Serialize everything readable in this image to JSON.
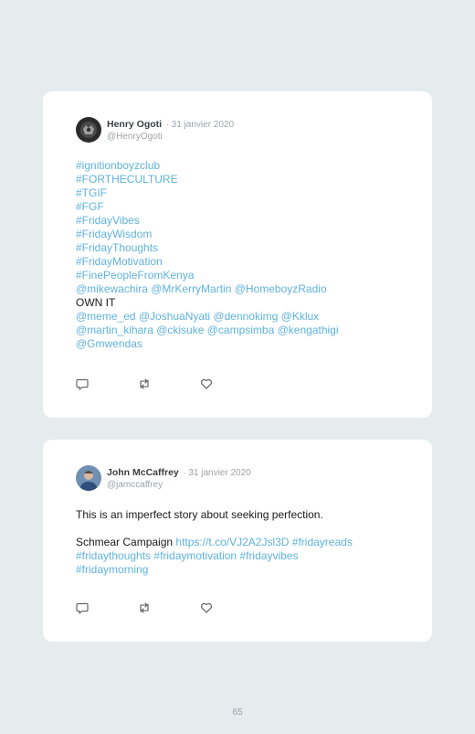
{
  "tweets": [
    {
      "name": "Henry Ogoti",
      "date": "· 31 janvier 2020",
      "handle": "@HenryOgoti",
      "lines": [
        [
          {
            "t": "#ignitionboyzclub",
            "link": true
          }
        ],
        [
          {
            "t": "#FORTHECULTURE",
            "link": true
          }
        ],
        [
          {
            "t": "#TGIF",
            "link": true
          }
        ],
        [
          {
            "t": "#FGF",
            "link": true
          }
        ],
        [
          {
            "t": "#FridayVibes",
            "link": true
          }
        ],
        [
          {
            "t": "#FridayWisdom",
            "link": true
          }
        ],
        [
          {
            "t": "#FridayThoughts",
            "link": true
          }
        ],
        [
          {
            "t": "#FridayMotivation",
            "link": true
          }
        ],
        [
          {
            "t": "#FinePeopleFromKenya",
            "link": true
          }
        ],
        [
          {
            "t": "@mikewachira @MrKerryMartin @HomeboyzRadio",
            "link": true
          }
        ],
        [
          {
            "t": "OWN IT",
            "link": false
          }
        ],
        [
          {
            "t": "@meme_ed @JoshuaNyati @dennokimg @Kklux",
            "link": true
          }
        ],
        [
          {
            "t": "@martin_kihara @ckisuke @campsimba @kengathigi",
            "link": true
          }
        ],
        [
          {
            "t": "@Gmwendas",
            "link": true
          }
        ]
      ]
    },
    {
      "name": "John McCaffrey",
      "date": "· 31 janvier 2020",
      "handle": "@jamccaffrey",
      "lines": [
        [
          {
            "t": "This is an imperfect story about seeking perfection.",
            "link": false
          }
        ],
        [],
        [
          {
            "t": "Schmear Campaign ",
            "link": false
          },
          {
            "t": "https://t.co/VJ2A2Jsl3D #fridayreads",
            "link": true
          }
        ],
        [
          {
            "t": "#fridaythoughts #fridaymotivation #fridayvibes",
            "link": true
          }
        ],
        [
          {
            "t": "#fridaymorning",
            "link": true
          }
        ]
      ]
    }
  ],
  "icons": [
    "reply-icon",
    "retweet-icon",
    "like-icon"
  ],
  "colors": {
    "link": "#5fb2dc",
    "background": "#e6ebee",
    "card": "#ffffff"
  },
  "page_number": "65"
}
